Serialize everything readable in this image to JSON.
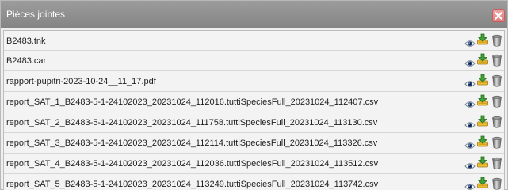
{
  "panel": {
    "title": "Pièces jointes",
    "close_icon": "close-icon",
    "accent_color": "#e07878"
  },
  "attachments": [
    {
      "name": "B2483.tnk"
    },
    {
      "name": "B2483.car"
    },
    {
      "name": "rapport-pupitri-2023-10-24__11_17.pdf"
    },
    {
      "name": "report_SAT_1_B2483-5-1-24102023_20231024_112016.tuttiSpeciesFull_20231024_112407.csv"
    },
    {
      "name": "report_SAT_2_B2483-5-1-24102023_20231024_111758.tuttiSpeciesFull_20231024_113130.csv"
    },
    {
      "name": "report_SAT_3_B2483-5-1-24102023_20231024_112114.tuttiSpeciesFull_20231024_113326.csv"
    },
    {
      "name": "report_SAT_4_B2483-5-1-24102023_20231024_112036.tuttiSpeciesFull_20231024_113512.csv"
    },
    {
      "name": "report_SAT_5_B2483-5-1-24102023_20231024_113249.tuttiSpeciesFull_20231024_113742.csv"
    }
  ],
  "row_icons": [
    "eye-icon",
    "download-icon",
    "trash-icon"
  ]
}
